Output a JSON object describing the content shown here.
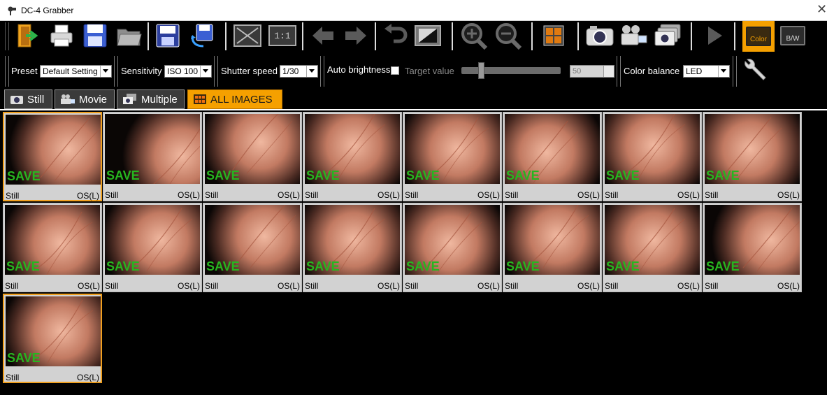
{
  "window": {
    "title": "DC-4 Grabber",
    "close_glyph": "✕"
  },
  "toolbar": {
    "buttons": [
      {
        "name": "exit-icon"
      },
      {
        "name": "print-icon"
      },
      {
        "name": "save-disk-icon"
      },
      {
        "name": "open-folder-icon"
      },
      {
        "name": "save-as-icon"
      },
      {
        "name": "export-icon"
      },
      {
        "name": "fit-window-icon"
      },
      {
        "name": "actual-size-icon",
        "label": "1:1"
      },
      {
        "name": "arrow-left-icon"
      },
      {
        "name": "arrow-right-icon"
      },
      {
        "name": "undo-icon"
      },
      {
        "name": "contrast-icon"
      },
      {
        "name": "zoom-in-icon"
      },
      {
        "name": "zoom-out-icon"
      },
      {
        "name": "grid-view-icon"
      },
      {
        "name": "still-camera-icon"
      },
      {
        "name": "video-camera-icon"
      },
      {
        "name": "multiple-camera-icon"
      },
      {
        "name": "play-icon"
      },
      {
        "name": "color-mode-icon",
        "label": "Color"
      },
      {
        "name": "bw-mode-icon",
        "label": "B/W"
      }
    ],
    "accent": "#f5a000"
  },
  "settings": {
    "preset_label": "Preset",
    "preset_value": "Default Setting",
    "sensitivity_label": "Sensitivity",
    "sensitivity_value": "ISO 100",
    "shutter_label": "Shutter speed",
    "shutter_value": "1/30",
    "auto_brightness_label": "Auto brightness",
    "target_label": "Target value",
    "target_value": "50",
    "target_fraction": 0.2,
    "color_balance_label": "Color balance",
    "color_balance_value": "LED"
  },
  "tabs": [
    {
      "label": "Still",
      "icon": "still-camera-icon"
    },
    {
      "label": "Movie",
      "icon": "movie-camera-icon"
    },
    {
      "label": "Multiple",
      "icon": "multiple-camera-icon"
    },
    {
      "label": "ALL IMAGES",
      "icon": "grid-icon",
      "active": true
    }
  ],
  "gallery": {
    "badge": "SAVE",
    "badge_color": "#27b51f",
    "items": [
      {
        "type": "Still",
        "eye": "OS(L)",
        "selected": true
      },
      {
        "type": "Still",
        "eye": "OS(L)"
      },
      {
        "type": "Still",
        "eye": "OS(L)"
      },
      {
        "type": "Still",
        "eye": "OS(L)"
      },
      {
        "type": "Still",
        "eye": "OS(L)"
      },
      {
        "type": "Still",
        "eye": "OS(L)"
      },
      {
        "type": "Still",
        "eye": "OS(L)"
      },
      {
        "type": "Still",
        "eye": "OS(L)"
      },
      {
        "type": "Still",
        "eye": "OS(L)"
      },
      {
        "type": "Still",
        "eye": "OS(L)"
      },
      {
        "type": "Still",
        "eye": "OS(L)"
      },
      {
        "type": "Still",
        "eye": "OS(L)"
      },
      {
        "type": "Still",
        "eye": "OS(L)"
      },
      {
        "type": "Still",
        "eye": "OS(L)"
      },
      {
        "type": "Still",
        "eye": "OS(L)"
      },
      {
        "type": "Still",
        "eye": "OS(L)"
      },
      {
        "type": "Still",
        "eye": "OS(L)",
        "selected": true
      }
    ]
  }
}
